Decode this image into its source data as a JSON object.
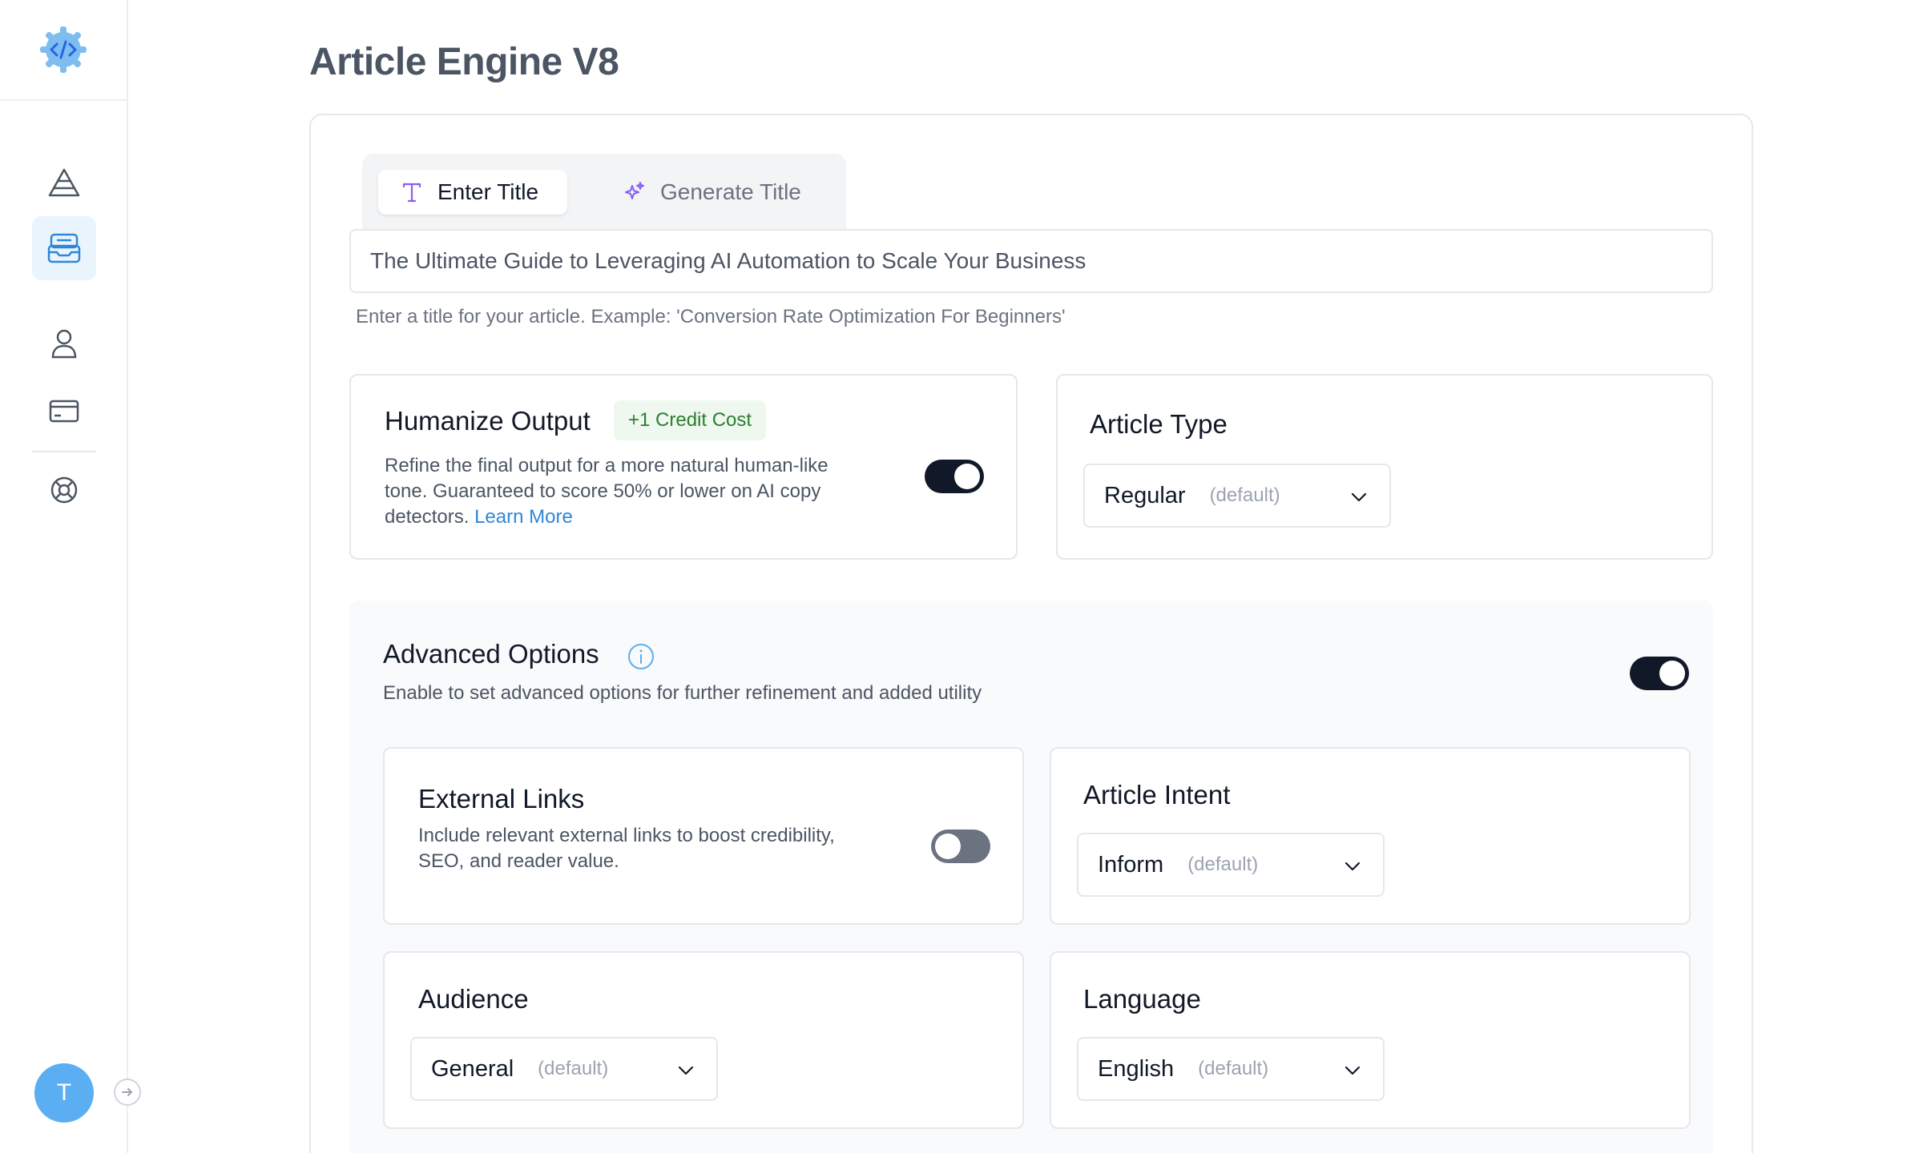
{
  "sidebar": {
    "logo_icon": "code-gear-icon",
    "nav_items": [
      {
        "name": "triangle-icon",
        "active": false
      },
      {
        "name": "inbox-icon",
        "active": true
      },
      {
        "name": "user-icon",
        "active": false
      },
      {
        "name": "credit-card-icon",
        "active": false
      },
      {
        "name": "support-icon",
        "active": false
      }
    ],
    "avatar_initial": "T"
  },
  "page": {
    "title": "Article Engine V8"
  },
  "title_tabs": {
    "enter": "Enter Title",
    "generate": "Generate Title"
  },
  "title_input": {
    "value": "The Ultimate Guide to Leveraging AI Automation to Scale Your Business",
    "helper": "Enter a title for your article. Example: 'Conversion Rate Optimization For Beginners'"
  },
  "humanize": {
    "title": "Humanize Output",
    "badge": "+1 Credit Cost",
    "desc_line1": "Refine the final output for a more natural human-like",
    "desc_line2": "tone. Guaranteed to score 50% or lower on AI copy",
    "desc_line3": "detectors.",
    "learn_more": "Learn More",
    "enabled": true
  },
  "article_type": {
    "title": "Article Type",
    "value": "Regular",
    "default_tag": "(default)"
  },
  "advanced": {
    "title": "Advanced Options",
    "desc": "Enable to set advanced options for further refinement and added utility",
    "enabled": true
  },
  "external_links": {
    "title": "External Links",
    "desc_line1": "Include relevant external links to boost credibility,",
    "desc_line2": "SEO, and reader value.",
    "enabled": false
  },
  "article_intent": {
    "title": "Article Intent",
    "value": "Inform",
    "default_tag": "(default)"
  },
  "audience": {
    "title": "Audience",
    "value": "General",
    "default_tag": "(default)"
  },
  "language": {
    "title": "Language",
    "value": "English",
    "default_tag": "(default)"
  },
  "colors": {
    "accent": "#5aaef1",
    "toggle_on": "#111827",
    "badge_text": "#2e7d32"
  }
}
